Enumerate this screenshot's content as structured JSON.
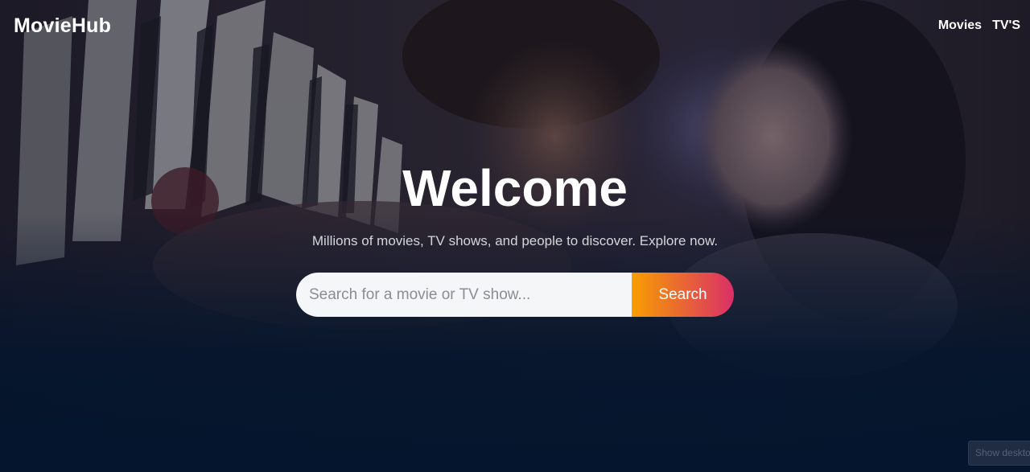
{
  "header": {
    "logo": "MovieHub",
    "nav": [
      {
        "label": "Movies"
      },
      {
        "label": "TV'S"
      }
    ]
  },
  "hero": {
    "title": "Welcome",
    "subtitle": "Millions of movies, TV shows, and people to discover. Explore now.",
    "search": {
      "placeholder": "Search for a movie or TV show...",
      "value": "",
      "button_label": "Search"
    }
  },
  "footer_widget": {
    "label": "Show desktop"
  },
  "colors": {
    "background": "#04152d",
    "button_gradient_start": "#f89e00",
    "button_gradient_end": "#da2f68"
  }
}
